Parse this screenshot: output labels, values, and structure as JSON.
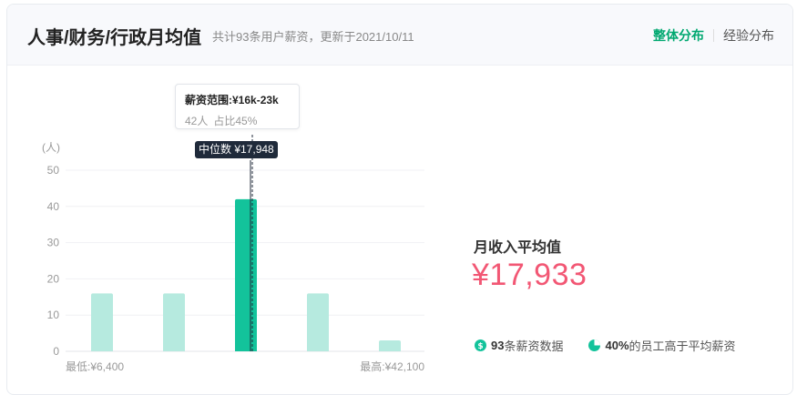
{
  "header": {
    "title": "人事/财务/行政月均值",
    "subtitle": "共计93条用户薪资，更新于2021/10/11",
    "tabs": [
      {
        "label": "整体分布",
        "active": true
      },
      {
        "label": "经验分布",
        "active": false
      }
    ]
  },
  "colors": {
    "accent": "#13c39b",
    "bar_light": "#b6eadf",
    "price": "#f25774",
    "tab_active": "#00a870",
    "tag_bg": "#1f2a3a"
  },
  "tooltip": {
    "range": "薪资范围:¥16k-23k",
    "count": "42人",
    "share": "占比45%"
  },
  "median_tag": "中位数 ¥17,948",
  "summary": {
    "avg_label": "月收入平均值",
    "avg_value": "¥17,933",
    "stat1_bold": "93",
    "stat1_text": "条薪资数据",
    "stat2_bold": "40%",
    "stat2_text": "的员工高于平均薪资"
  },
  "chart_data": {
    "type": "bar",
    "ylabel": "(人)",
    "ylim": [
      0,
      50
    ],
    "yticks": [
      0,
      10,
      20,
      30,
      40,
      50
    ],
    "values": [
      16,
      16,
      42,
      16,
      3
    ],
    "highlight_index": 2,
    "x_min_label": "最低:¥6,400",
    "x_max_label": "最高:¥42,100",
    "median": 17948,
    "grid": true
  }
}
